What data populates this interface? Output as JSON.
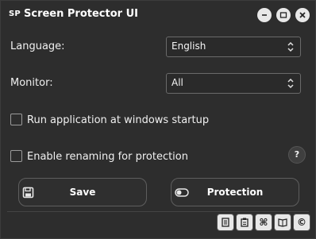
{
  "app": {
    "icon_text": "SP",
    "title": "Screen Protector UI"
  },
  "settings": {
    "language_label": "Language:",
    "language_value": "English",
    "monitor_label": "Monitor:",
    "monitor_value": "All",
    "startup_label": "Run application at windows startup",
    "startup_checked": false,
    "renaming_label": "Enable renaming for protection",
    "renaming_checked": false,
    "help_text": "?"
  },
  "actions": {
    "save_label": "Save",
    "protection_label": "Protection"
  },
  "footer": {
    "items": [
      "document-icon",
      "clipboard-icon",
      "command-icon",
      "book-icon",
      "copyright-icon"
    ]
  },
  "colors": {
    "background": "#2d2d2d",
    "text": "#f0f0f0",
    "border": "#6a6a6a"
  }
}
